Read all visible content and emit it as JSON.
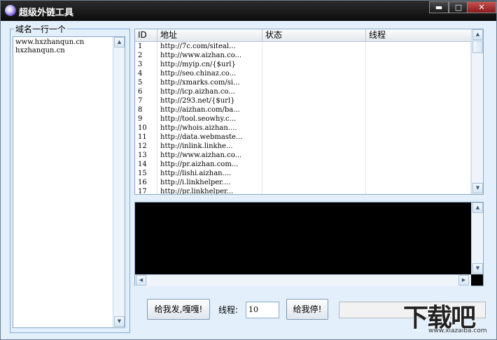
{
  "window": {
    "title": "超级外链工具",
    "controls": {
      "minimize": "▬",
      "maximize": "□",
      "close": "✕"
    }
  },
  "domains": {
    "group_label": "域名一行一个",
    "lines": [
      "www.hxzhanqun.cn",
      "hxzhanqun.cn"
    ]
  },
  "table": {
    "columns": [
      "ID",
      "地址",
      "状态",
      "线程"
    ],
    "rows": [
      {
        "id": "1",
        "url": "http://7c.com/siteal...",
        "status": "",
        "thread": ""
      },
      {
        "id": "2",
        "url": "http://www.aizhan.co...",
        "status": "",
        "thread": ""
      },
      {
        "id": "3",
        "url": "http://myip.cn/{$url}",
        "status": "",
        "thread": ""
      },
      {
        "id": "4",
        "url": "http://seo.chinaz.co...",
        "status": "",
        "thread": ""
      },
      {
        "id": "5",
        "url": "http://xmarks.com/si...",
        "status": "",
        "thread": ""
      },
      {
        "id": "6",
        "url": "http://icp.aizhan.co...",
        "status": "",
        "thread": ""
      },
      {
        "id": "7",
        "url": "http://293.net/{$url}",
        "status": "",
        "thread": ""
      },
      {
        "id": "8",
        "url": "http://aizhan.com/ba...",
        "status": "",
        "thread": ""
      },
      {
        "id": "9",
        "url": "http://tool.seowhy.c...",
        "status": "",
        "thread": ""
      },
      {
        "id": "10",
        "url": "http://whois.aizhan....",
        "status": "",
        "thread": ""
      },
      {
        "id": "11",
        "url": "http://data.webmaste...",
        "status": "",
        "thread": ""
      },
      {
        "id": "12",
        "url": "http://inlink.linkhe...",
        "status": "",
        "thread": ""
      },
      {
        "id": "13",
        "url": "http://www.aizhan.co...",
        "status": "",
        "thread": ""
      },
      {
        "id": "14",
        "url": "http://pr.aizhan.com...",
        "status": "",
        "thread": ""
      },
      {
        "id": "15",
        "url": "http://lishi.aizhan....",
        "status": "",
        "thread": ""
      },
      {
        "id": "16",
        "url": "http://i.linkhelper....",
        "status": "",
        "thread": ""
      },
      {
        "id": "17",
        "url": "http://pr.linkhelper...",
        "status": "",
        "thread": ""
      }
    ]
  },
  "controls": {
    "start_label": "给我发,嘎嘎!",
    "threads_label": "线程:",
    "threads_value": "10",
    "stop_label": "给我停!"
  },
  "watermark": {
    "main": "下载吧",
    "sub": "www.xiazaiba.com"
  },
  "colors": {
    "window_bg": "#e3f0fb",
    "titlebar": "#0c0c0c",
    "console_bg": "#000000"
  }
}
